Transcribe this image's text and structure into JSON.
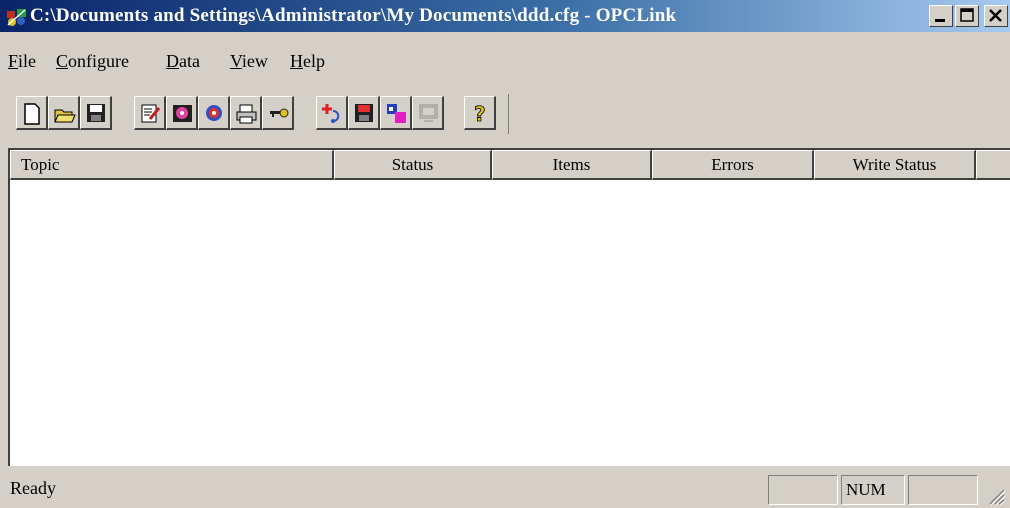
{
  "window": {
    "title": "C:\\Documents and Settings\\Administrator\\My Documents\\ddd.cfg - OPCLink",
    "title_bar_color": "#0a246a",
    "icons": {
      "app": "opclink-app-icon",
      "minimize": "minimize-icon",
      "maximize": "maximize-icon",
      "close": "close-icon"
    }
  },
  "menu": {
    "items": [
      {
        "label": "File"
      },
      {
        "label": "Configure"
      },
      {
        "label": "Data"
      },
      {
        "label": "View"
      },
      {
        "label": "Help"
      }
    ]
  },
  "toolbar": {
    "buttons": [
      {
        "icon": "new-document-icon"
      },
      {
        "icon": "open-folder-icon"
      },
      {
        "icon": "save-disk-icon"
      },
      {
        "icon": "edit-document-icon"
      },
      {
        "icon": "disk-pink-icon"
      },
      {
        "icon": "gear-red-icon"
      },
      {
        "icon": "printer-icon"
      },
      {
        "icon": "key-icon"
      },
      {
        "icon": "add-topic-icon"
      },
      {
        "icon": "save-red-disk-icon"
      },
      {
        "icon": "database-icon"
      },
      {
        "icon": "monitor-disabled-icon"
      },
      {
        "icon": "help-question-icon"
      }
    ]
  },
  "list": {
    "columns": [
      "Topic",
      "Status",
      "Items",
      "Errors",
      "Write Status"
    ],
    "rows": []
  },
  "statusbar": {
    "text": "Ready",
    "num_indicator": "NUM",
    "caps_indicator": "",
    "scroll_indicator": ""
  }
}
